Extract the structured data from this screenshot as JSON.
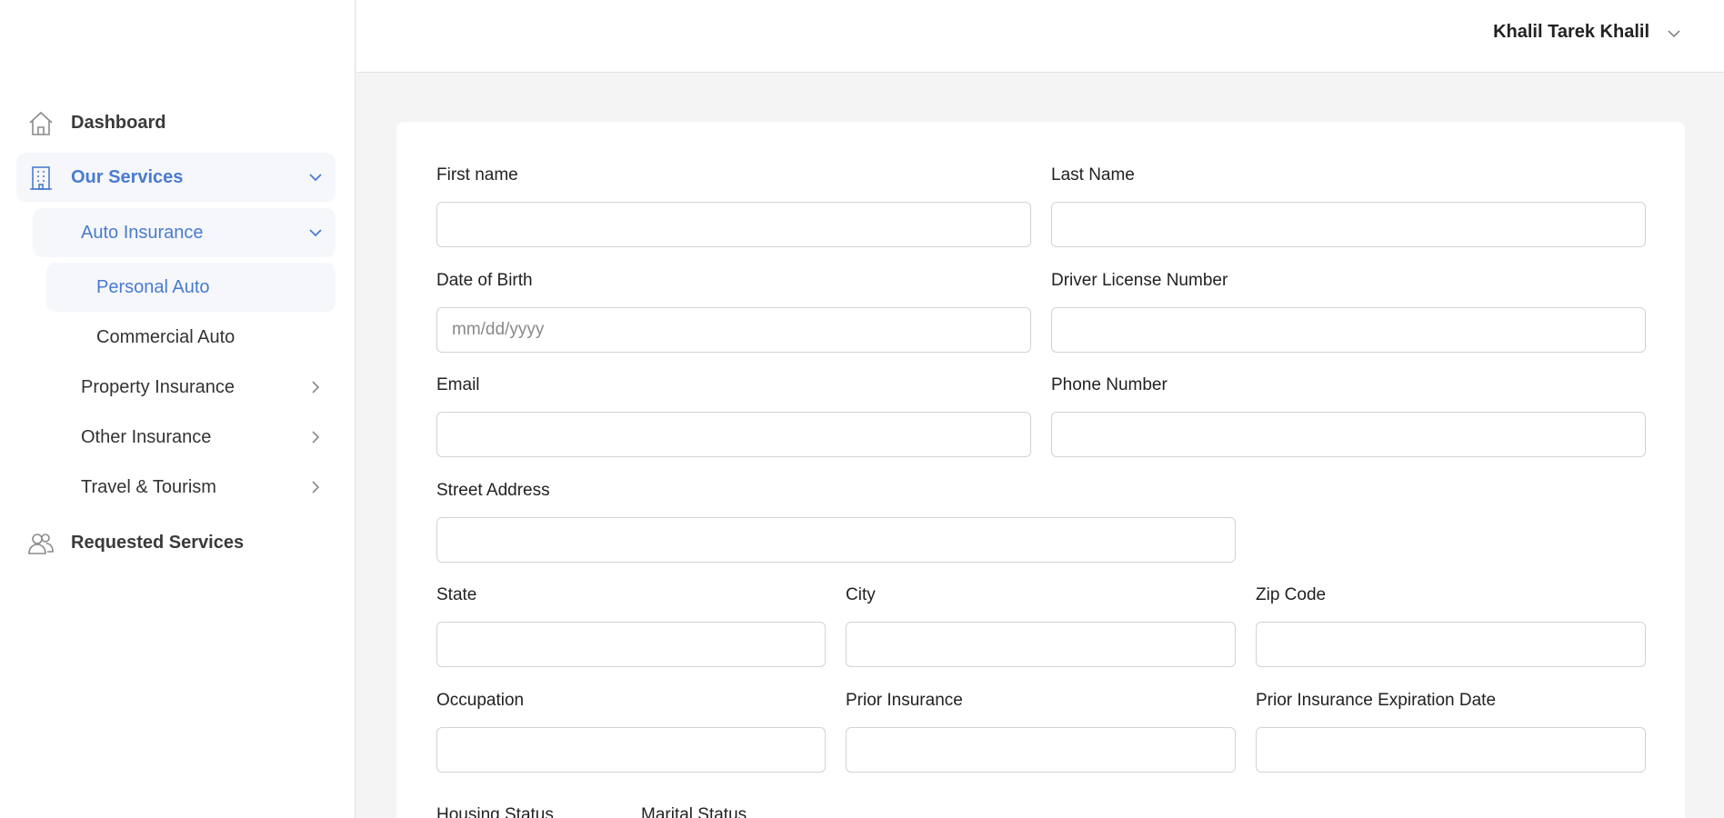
{
  "sidebar": {
    "dashboard": "Dashboard",
    "our_services": "Our Services",
    "auto_insurance": "Auto Insurance",
    "personal_auto": "Personal Auto",
    "commercial_auto": "Commercial Auto",
    "property_insurance": "Property Insurance",
    "other_insurance": "Other Insurance",
    "travel_tourism": "Travel & Tourism",
    "requested_services": "Requested Services"
  },
  "header": {
    "user_name": "Khalil Tarek Khalil"
  },
  "form": {
    "first_name": {
      "label": "First name",
      "value": ""
    },
    "last_name": {
      "label": "Last Name",
      "value": ""
    },
    "dob": {
      "label": "Date of Birth",
      "placeholder": "mm/dd/yyyy"
    },
    "license": {
      "label": "Driver License Number",
      "value": ""
    },
    "email": {
      "label": "Email",
      "value": ""
    },
    "phone": {
      "label": "Phone Number",
      "value": ""
    },
    "street": {
      "label": "Street Address",
      "value": ""
    },
    "state": {
      "label": "State",
      "value": ""
    },
    "city": {
      "label": "City",
      "value": ""
    },
    "zip": {
      "label": "Zip Code",
      "value": ""
    },
    "occupation": {
      "label": "Occupation",
      "value": ""
    },
    "prior_insurance": {
      "label": "Prior Insurance",
      "value": ""
    },
    "prior_exp": {
      "label": "Prior Insurance Expiration Date",
      "value": ""
    },
    "housing_status": {
      "label": "Housing Status"
    },
    "marital_status": {
      "label": "Marital Status"
    }
  },
  "colors": {
    "accent": "#4a7bd0",
    "active_bg": "#f5f7fb",
    "page_bg": "#f4f4f4"
  }
}
